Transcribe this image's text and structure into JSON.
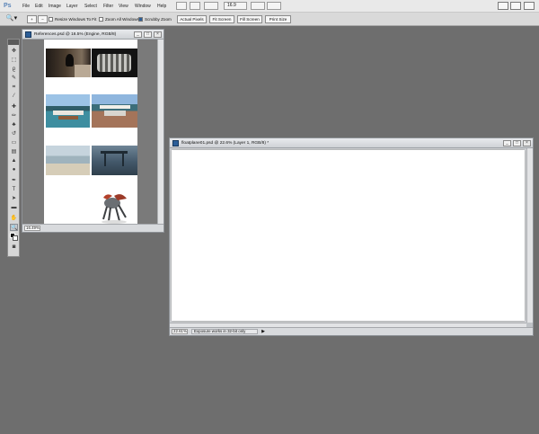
{
  "app": {
    "logo": "Ps"
  },
  "menubar": {
    "items": [
      "File",
      "Edit",
      "Image",
      "Layer",
      "Select",
      "Filter",
      "View",
      "Window",
      "Help"
    ],
    "zoom_value": "16.9"
  },
  "options_bar": {
    "resize_windows": "Resize Windows To Fit",
    "zoom_all_windows": "Zoom All Windows",
    "scrubby_zoom": "Scrubby Zoom",
    "actual_pixels": "Actual Pixels",
    "fit_screen": "Fit Screen",
    "fill_screen": "Fill Screen",
    "print_size": "Print Size"
  },
  "references_window": {
    "title": "References.psd @ 16.5% (Engine, RGB/8)",
    "zoom": "16.49%"
  },
  "floatplane_window": {
    "title": "floatplane01.psd @ 22.6% (Layer 1, RGB/8) *",
    "zoom": "22.61%",
    "status": "Exposure works in 32-bit only"
  },
  "colors": {
    "workspace": "#6e6e6e",
    "menubar": "#e9e9e9",
    "window_frame": "#bfc2c6",
    "accent": "#2c5e98"
  }
}
